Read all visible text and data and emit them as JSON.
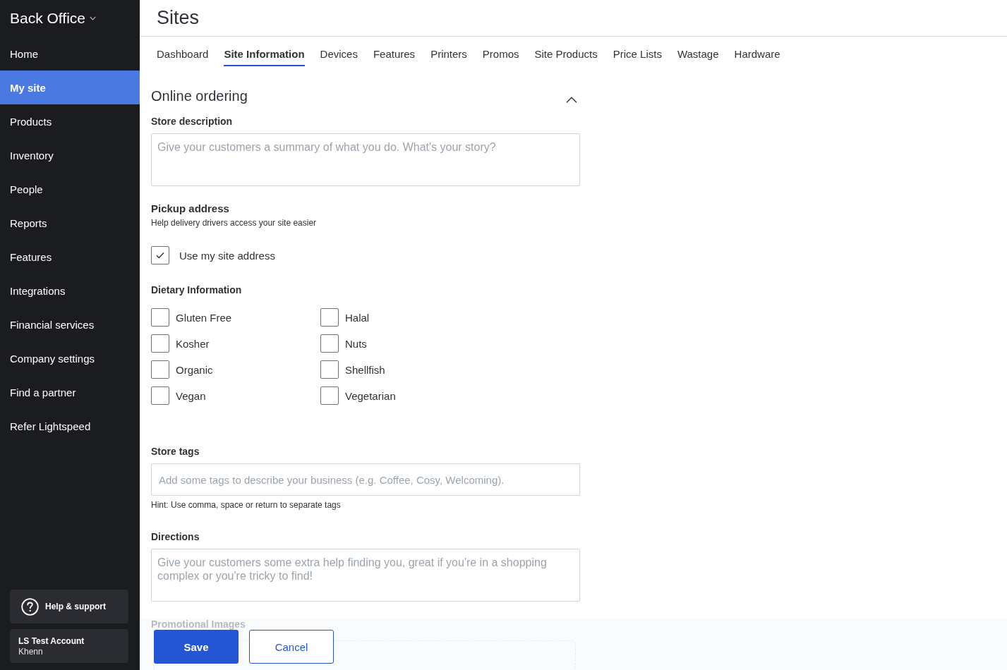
{
  "sidebar": {
    "title": "Back Office",
    "items": [
      {
        "label": "Home",
        "selected": false
      },
      {
        "label": "My site",
        "selected": true
      },
      {
        "label": "Products",
        "selected": false
      },
      {
        "label": "Inventory",
        "selected": false
      },
      {
        "label": "People",
        "selected": false
      },
      {
        "label": "Reports",
        "selected": false
      },
      {
        "label": "Features",
        "selected": false
      },
      {
        "label": "Integrations",
        "selected": false
      },
      {
        "label": "Financial services",
        "selected": false
      },
      {
        "label": "Company settings",
        "selected": false
      },
      {
        "label": "Find a partner",
        "selected": false
      },
      {
        "label": "Refer Lightspeed",
        "selected": false
      }
    ],
    "help": {
      "label": "Help & support"
    },
    "account": {
      "name": "LS Test Account",
      "user": "Khenn"
    }
  },
  "header": {
    "title": "Sites"
  },
  "tabs": [
    {
      "label": "Dashboard",
      "selected": false
    },
    {
      "label": "Site Information",
      "selected": true
    },
    {
      "label": "Devices",
      "selected": false
    },
    {
      "label": "Features",
      "selected": false
    },
    {
      "label": "Printers",
      "selected": false
    },
    {
      "label": "Promos",
      "selected": false
    },
    {
      "label": "Site Products",
      "selected": false
    },
    {
      "label": "Price Lists",
      "selected": false
    },
    {
      "label": "Wastage",
      "selected": false
    },
    {
      "label": "Hardware",
      "selected": false
    }
  ],
  "section": {
    "title": "Online ordering",
    "expanded": true,
    "store_description": {
      "label": "Store description",
      "placeholder": "Give your customers a summary of what you do. What's your story?"
    },
    "pickup_address": {
      "label": "Pickup address",
      "help": "Help delivery drivers access your site easier",
      "checkbox": {
        "label": "Use my site address",
        "checked": true
      }
    },
    "dietary": {
      "label": "Dietary Information",
      "options": [
        {
          "label": "Gluten Free",
          "checked": false
        },
        {
          "label": "Halal",
          "checked": false
        },
        {
          "label": "Kosher",
          "checked": false
        },
        {
          "label": "Nuts",
          "checked": false
        },
        {
          "label": "Organic",
          "checked": false
        },
        {
          "label": "Shellfish",
          "checked": false
        },
        {
          "label": "Vegan",
          "checked": false
        },
        {
          "label": "Vegetarian",
          "checked": false
        }
      ]
    },
    "store_tags": {
      "label": "Store tags",
      "placeholder": "Add some tags to describe your business (e.g. Coffee, Cosy, Welcoming).",
      "hint": "Hint: Use comma, space or return to separate tags"
    },
    "directions": {
      "label": "Directions",
      "placeholder": "Give your customers some extra help finding you, great if you're in a shopping complex or you're tricky to find!"
    },
    "promotional_images": {
      "label": "Promotional Images"
    }
  },
  "footer": {
    "buttons": [
      {
        "label": "Save",
        "kind": "primary"
      },
      {
        "label": "Cancel",
        "kind": "secondary"
      }
    ]
  }
}
